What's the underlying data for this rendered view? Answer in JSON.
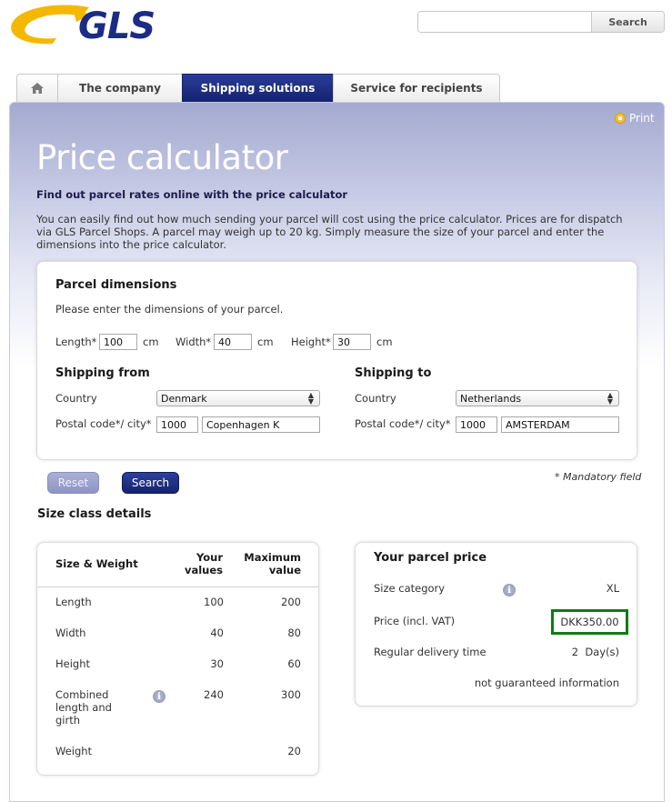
{
  "brand": {
    "logo_text": "GLS",
    "accent": "#1b2c86",
    "swoosh_color": "#f5b800"
  },
  "header": {
    "search_placeholder": "",
    "search_button": "Search"
  },
  "nav": {
    "home_icon": "home-icon",
    "items": [
      {
        "label": "The company",
        "active": false
      },
      {
        "label": "Shipping solutions",
        "active": true
      },
      {
        "label": "Service for recipients",
        "active": false
      }
    ]
  },
  "page": {
    "print_label": "Print",
    "title": "Price calculator",
    "subtitle": "Find out parcel rates online with the price calculator",
    "intro": "You can easily find out how much sending your parcel will cost using the price calculator. Prices are for dispatch via GLS Parcel Shops. A parcel may weigh up to 20 kg. Simply measure the size of your parcel and enter the dimensions into the price calculator."
  },
  "dimensions": {
    "heading": "Parcel dimensions",
    "instruction": "Please enter the dimensions of your parcel.",
    "length_label": "Length*",
    "length_value": "100",
    "width_label": "Width*",
    "width_value": "40",
    "height_label": "Height*",
    "height_value": "30",
    "unit": "cm"
  },
  "shipping_from": {
    "heading": "Shipping from",
    "country_label": "Country",
    "country_value": "Denmark",
    "postal_label": "Postal code*/ city*",
    "postal_value": "1000",
    "city_value": "Copenhagen K"
  },
  "shipping_to": {
    "heading": "Shipping to",
    "country_label": "Country",
    "country_value": "Netherlands",
    "postal_label": "Postal code*/ city*",
    "postal_value": "1000",
    "city_value": "AMSTERDAM"
  },
  "actions": {
    "reset_label": "Reset",
    "search_label": "Search",
    "mandatory_note": "* Mandatory field"
  },
  "size_details": {
    "title": "Size class details",
    "headers": {
      "col1": "Size & Weight",
      "col2_line1": "Your",
      "col2_line2": "values",
      "col3_line1": "Maximum",
      "col3_line2": "value"
    },
    "rows": [
      {
        "label": "Length",
        "value": "100",
        "max": "200"
      },
      {
        "label": "Width",
        "value": "40",
        "max": "80"
      },
      {
        "label": "Height",
        "value": "30",
        "max": "60"
      },
      {
        "label_line1": "Combined",
        "label_line2": "length and",
        "label_line3": "girth",
        "value": "240",
        "max": "300"
      },
      {
        "label": "Weight",
        "value": "",
        "max": "20"
      }
    ]
  },
  "price": {
    "heading": "Your parcel price",
    "size_category_label": "Size category",
    "size_category_value": "XL",
    "price_label": "Price (incl. VAT)",
    "price_value": "DKK350.00",
    "delivery_label": "Regular delivery time",
    "delivery_value": "2  Day(s)",
    "note": "not guaranteed information",
    "highlight_color": "#0f7a17"
  }
}
